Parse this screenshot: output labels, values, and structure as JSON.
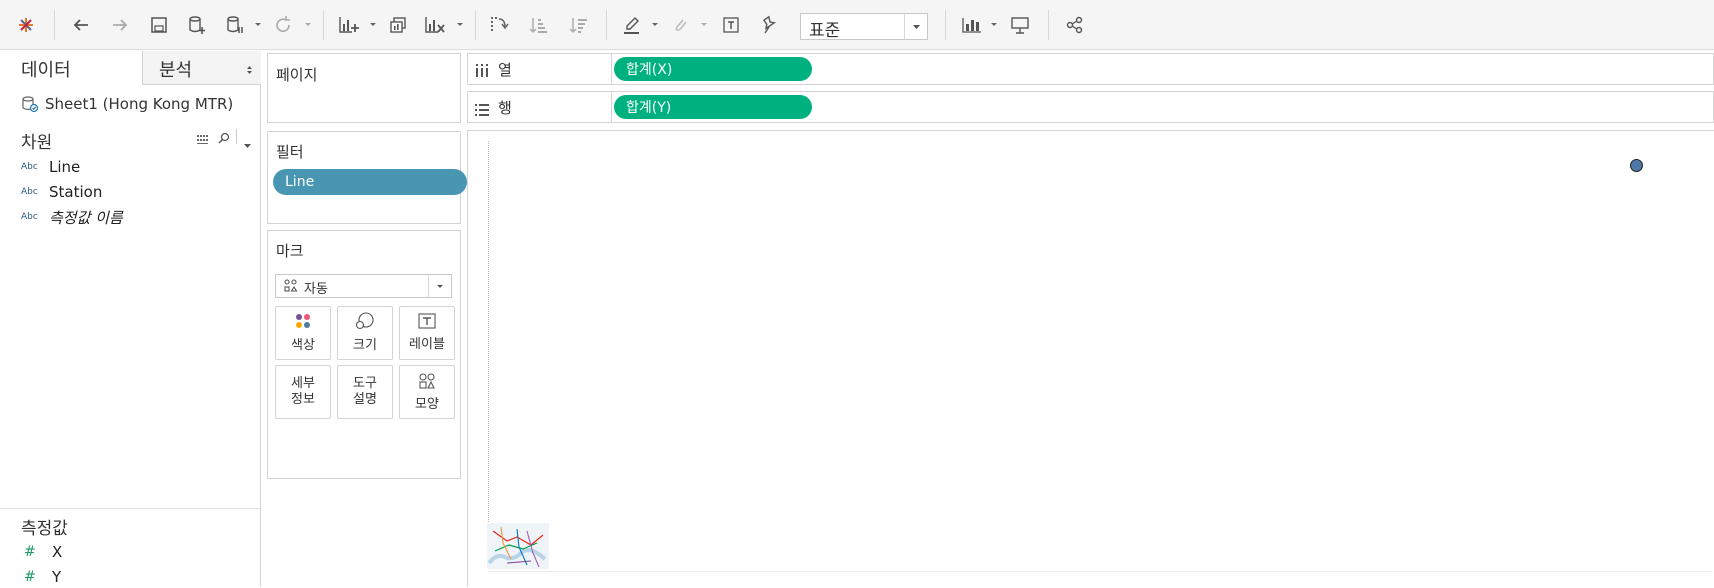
{
  "toolbar": {
    "fit_value": "표준"
  },
  "data_pane": {
    "tab_data": "데이터",
    "tab_analysis": "분석",
    "datasource": "Sheet1 (Hong Kong MTR)",
    "dimensions_title": "차원",
    "dimensions": [
      {
        "type": "Abc",
        "name": "Line"
      },
      {
        "type": "Abc",
        "name": "Station"
      },
      {
        "type": "Abc",
        "name": "측정값 이름"
      }
    ],
    "measures_title": "측정값",
    "measures": [
      {
        "type": "#",
        "name": "X"
      },
      {
        "type": "#",
        "name": "Y"
      }
    ]
  },
  "pages_card": {
    "title": "페이지"
  },
  "filters_card": {
    "title": "필터",
    "pills": [
      "Line"
    ]
  },
  "marks_card": {
    "title": "마크",
    "mark_type": "자동",
    "buttons": {
      "color": "색상",
      "size": "크기",
      "label": "레이블",
      "detail_1": "세부",
      "detail_2": "정보",
      "tooltip_1": "도구",
      "tooltip_2": "설명",
      "shape": "모양"
    }
  },
  "shelves": {
    "columns_label": "열",
    "columns_pill": "합계(X)",
    "rows_label": "행",
    "rows_pill": "합계(Y)"
  },
  "colors": {
    "measure_pill": "#00b180",
    "dimension_pill": "#4996b2",
    "mark_point": "#4e79a7"
  }
}
